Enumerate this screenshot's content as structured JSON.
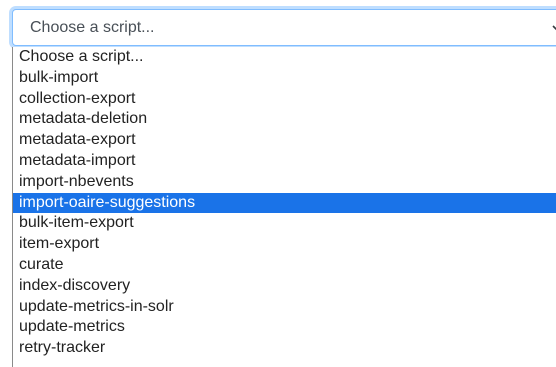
{
  "select": {
    "value": "Choose a script...",
    "icon": "chevron-down-icon"
  },
  "options": [
    {
      "label": "Choose a script..."
    },
    {
      "label": "bulk-import"
    },
    {
      "label": "collection-export"
    },
    {
      "label": "metadata-deletion"
    },
    {
      "label": "metadata-export"
    },
    {
      "label": "metadata-import"
    },
    {
      "label": "import-nbevents"
    },
    {
      "label": "import-oaire-suggestions",
      "highlighted": true
    },
    {
      "label": "bulk-item-export"
    },
    {
      "label": "item-export"
    },
    {
      "label": "curate"
    },
    {
      "label": "index-discovery"
    },
    {
      "label": "update-metrics-in-solr"
    },
    {
      "label": "update-metrics"
    },
    {
      "label": "retry-tracker"
    }
  ],
  "colors": {
    "focus_border": "#80bdff",
    "highlight_bg": "#1a73e8",
    "highlight_text": "#ffffff",
    "text": "#222222"
  }
}
